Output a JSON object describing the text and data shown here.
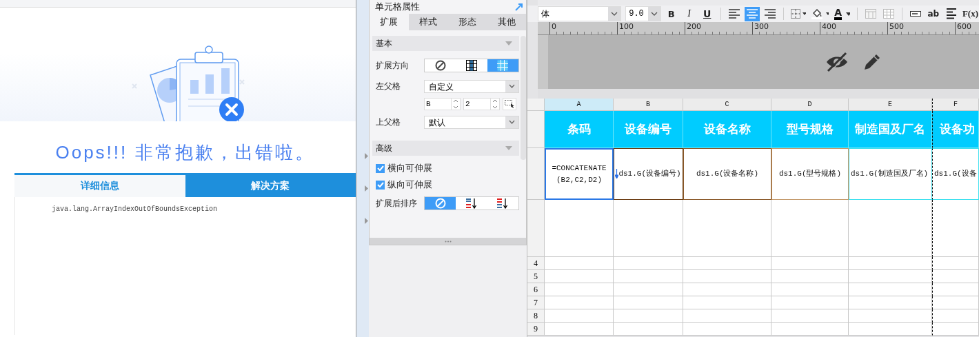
{
  "error_page": {
    "title": "Oops!!! 非常抱歉，出错啦。",
    "tabs": [
      {
        "label": "详细信息",
        "selected": true
      },
      {
        "label": "解决方案",
        "selected": false
      }
    ],
    "detail": "java.lang.ArrayIndexOutOfBoundsException"
  },
  "cell_properties": {
    "title": "单元格属性",
    "tabs": [
      {
        "label": "扩展",
        "selected": true
      },
      {
        "label": "样式",
        "selected": false
      },
      {
        "label": "形态",
        "selected": false
      },
      {
        "label": "其他",
        "selected": false
      }
    ],
    "sections": [
      {
        "title": "基本",
        "rows": [
          {
            "kind": "segmented",
            "label": "扩展方向",
            "options": [
              {
                "kind": "none",
                "selected": false
              },
              {
                "kind": "vertical",
                "selected": false
              },
              {
                "kind": "cross",
                "selected": true
              }
            ]
          },
          {
            "kind": "dropdown",
            "label": "左父格",
            "value": "自定义"
          },
          {
            "kind": "spinners",
            "values": [
              "B",
              "2"
            ]
          },
          {
            "kind": "dropdown",
            "label": "上父格",
            "value": "默认"
          }
        ]
      },
      {
        "title": "高级",
        "rows": [
          {
            "kind": "checkbox",
            "label": "横向可伸展",
            "checked": true
          },
          {
            "kind": "checkbox",
            "label": "纵向可伸展",
            "checked": true
          },
          {
            "kind": "segmented",
            "label": "扩展后排序",
            "options": [
              {
                "kind": "none",
                "selected": true
              },
              {
                "kind": "ascending",
                "selected": false
              },
              {
                "kind": "descending",
                "selected": false
              }
            ]
          }
        ]
      }
    ]
  },
  "toolbar": {
    "font": "体",
    "font_size": "9.0",
    "buttons": [
      {
        "kind": "bold",
        "label": "B",
        "selected": false
      },
      {
        "kind": "italic",
        "label": "I",
        "selected": false
      },
      {
        "kind": "underline",
        "label": "U",
        "selected": false
      },
      {
        "kind": "align-left",
        "selected": false
      },
      {
        "kind": "align-center",
        "selected": true
      },
      {
        "kind": "align-right",
        "selected": false
      },
      {
        "kind": "border",
        "selected": false
      },
      {
        "kind": "fill",
        "selected": false
      },
      {
        "kind": "font-color",
        "label": "A",
        "selected": false
      },
      {
        "kind": "merge",
        "selected": false
      },
      {
        "kind": "grid",
        "selected": false
      },
      {
        "kind": "textfield",
        "selected": false
      },
      {
        "kind": "text",
        "label": "ab",
        "selected": false
      },
      {
        "kind": "justify",
        "selected": false
      },
      {
        "kind": "formula",
        "label": "F(x)",
        "selected": false
      }
    ]
  },
  "ruler": {
    "ticks": [
      "0",
      "100",
      "200",
      "300",
      "400",
      "500",
      "600"
    ]
  },
  "sheet": {
    "columns": [
      {
        "label": "A",
        "selected": true
      },
      {
        "label": "B",
        "selected": false
      },
      {
        "label": "C",
        "selected": false
      },
      {
        "label": "D",
        "selected": false
      },
      {
        "label": "E",
        "selected": false
      },
      {
        "label": "F",
        "selected": false
      }
    ],
    "rows": [
      {
        "kind": "header",
        "cells": [
          {
            "text": "条码",
            "selected": false
          },
          {
            "text": "设备编号",
            "selected": false
          },
          {
            "text": "设备名称",
            "selected": false
          },
          {
            "text": "型号规格",
            "selected": false
          },
          {
            "text": "制造国及厂名",
            "selected": false
          },
          {
            "text": "设备功",
            "selected": false
          }
        ]
      },
      {
        "kind": "data",
        "cells": [
          {
            "text": "=CONCATENATE(B2,C2,D2)",
            "selected": true
          },
          {
            "text": "ds1.G(设备编号)",
            "selected": false,
            "expand": true
          },
          {
            "text": "ds1.G(设备名称)",
            "selected": false
          },
          {
            "text": "ds1.G(型号规格)",
            "selected": false
          },
          {
            "text": "ds1.G(制造国及厂名)",
            "selected": false
          },
          {
            "text": "ds1.G(设备",
            "selected": false
          }
        ]
      },
      {
        "kind": "blank"
      },
      {
        "kind": "numbered",
        "number": "4"
      },
      {
        "kind": "numbered",
        "number": "5"
      },
      {
        "kind": "numbered",
        "number": "6"
      },
      {
        "kind": "numbered",
        "number": "7"
      },
      {
        "kind": "numbered",
        "number": "8"
      },
      {
        "kind": "numbered",
        "number": "9"
      }
    ]
  }
}
